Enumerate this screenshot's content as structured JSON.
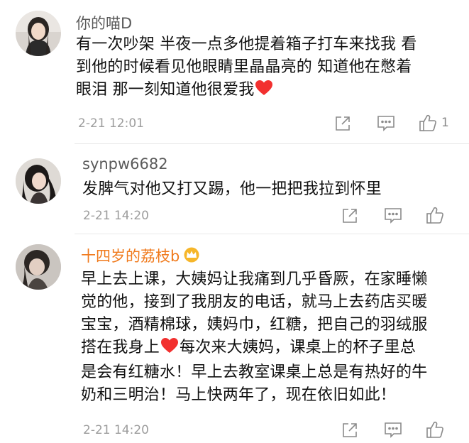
{
  "comments": [
    {
      "username": "你的喵D",
      "lines": [
        "有一次吵架 半夜一点多他提着箱子打车来找我  看",
        "到他的时候看见他眼睛里晶晶亮的  知道他在憋着",
        "眼泪   那一刻知道他很爱我"
      ],
      "timestamp": "2-21 12:01",
      "like_count": "1"
    },
    {
      "username": "synpw6682",
      "lines": [
        "发脾气对他又打又踢，他一把把我拉到怀里"
      ],
      "timestamp": "2-21 14:20",
      "like_count": ""
    },
    {
      "username": "十四岁的荔枝b",
      "lines": [
        "早上去上课，大姨妈让我痛到几乎昏厥，在家睡懒",
        "觉的他，接到了我朋友的电话，就马上去药店买暖",
        "宝宝，酒精棉球，姨妈巾，红糖，把自己的羽绒服",
        "搭在我身上",
        "每次来大姨妈，课桌上的杯子里总",
        "是会有红糖水！早上去教室课桌上总是有热好的牛",
        "奶和三明治！马上快两年了，现在依旧如此！"
      ],
      "timestamp": "2-21 14:20",
      "like_count": ""
    }
  ],
  "icons": [
    "share-icon",
    "comment-icon",
    "like-icon",
    "heart-icon",
    "crown-icon"
  ],
  "colors": {
    "vip_name": "#f07a1c",
    "name": "#5a5a5a",
    "time": "#9d9d9d",
    "heart": "#f2302f"
  }
}
